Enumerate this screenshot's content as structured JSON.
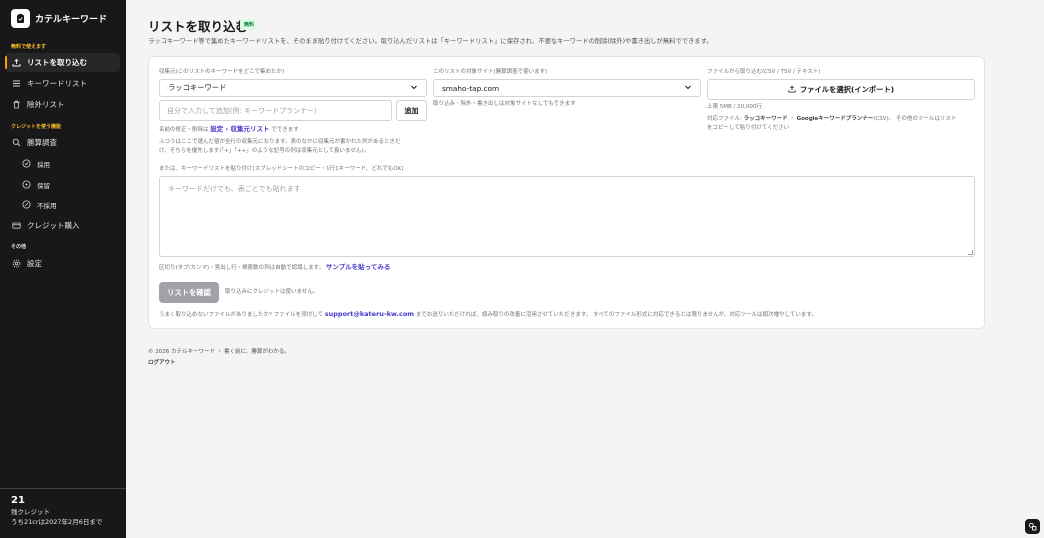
{
  "brand": {
    "name": "カテルキーワード"
  },
  "sidebar": {
    "section_free": "無料で使えます",
    "section_credit": "クレジットを使う機能",
    "section_other": "その他",
    "items": {
      "import": "リストを取り込む",
      "keyword_list": "キーワードリスト",
      "exclude_list": "除外リスト",
      "research": "勝算調査",
      "adopt": "採用",
      "hold": "保留",
      "reject": "不採用",
      "buy_credit": "クレジット購入",
      "settings": "設定"
    },
    "credits": {
      "count": "21",
      "label": "残クレジット",
      "expiry": "うち21crは2027年2月6日まで"
    }
  },
  "main": {
    "title": "リストを取り込む",
    "badge": "無料",
    "description": "ラッコキーワード等で集めたキーワードリストを、そのまま貼り付けてください。取り込んだリストは「キーワードリスト」に保存され、不要なキーワードの削除(除外)や書き出しが無料でできます。",
    "source": {
      "label": "収集元(このリストのキーワードをどこで集めたか)",
      "value": "ラッコキーワード",
      "custom_placeholder": "自分で入力して追加(例: キーワードプランナー)",
      "add_button": "追加",
      "edit_note_prefix": "名前の修正・削除は",
      "edit_link": "設定 › 収集元リスト",
      "edit_note_suffix": "でできます",
      "help_line1": "ふつうはここで選んだ値が全行の収集元になります。表のなかに収集元が書かれた列があるときだ",
      "help_line2": "け、そちらを優先します(「+」「++」のような記号の列は収集元として扱いません)。"
    },
    "target_site": {
      "label": "このリストの対象サイト(勝算調査で使います)",
      "value": "smaho-tap.com",
      "note": "取り込み・除外・書き出しは対象サイトなしでもできます"
    },
    "file_import": {
      "label": "ファイルから取り込む(CSV / TSV / テキスト)",
      "button": "ファイルを選択(インポート)",
      "limit": "上限 5MB / 20,000行",
      "supported_prefix": "対応ファイル: ",
      "supported_tool1": "ラッコキーワード",
      "supported_sep": " ・ ",
      "supported_tool2": "Googleキーワードプランナー",
      "supported_suffix": "(CSV)。 その他のツールはリスト",
      "supported_line2": "をコピーして貼り付けてください"
    },
    "paste": {
      "label": "または、キーワードリストを貼り付け(スプレッドシートのコピー・1行1キーワード、どれでもOK)",
      "placeholder": "キーワードだけでも、表ごとでも貼れます",
      "delimiter_note": "区切り(タブ/カンマ)・見出し行・検索数の列は自動で認識します。",
      "sample_link": "サンプルを貼ってみる"
    },
    "confirm": {
      "button": "リストを確認",
      "note": "取り込みにクレジットは使いません。"
    },
    "support": {
      "prefix": "うまく取り込めないファイルがありましたか? ファイルを添付して",
      "email": "support@kateru-kw.com",
      "suffix": "までお送りいただければ、読み取りの改善に活用させていただきます。 すべてのファイル形式に対応できるとは限りませんが、対応ツールは順次増やしています。"
    }
  },
  "footer": {
    "copyright": "© 2026 カテルキーワード ・ 書く前に、勝算がわかる。",
    "logout": "ログアウト"
  }
}
